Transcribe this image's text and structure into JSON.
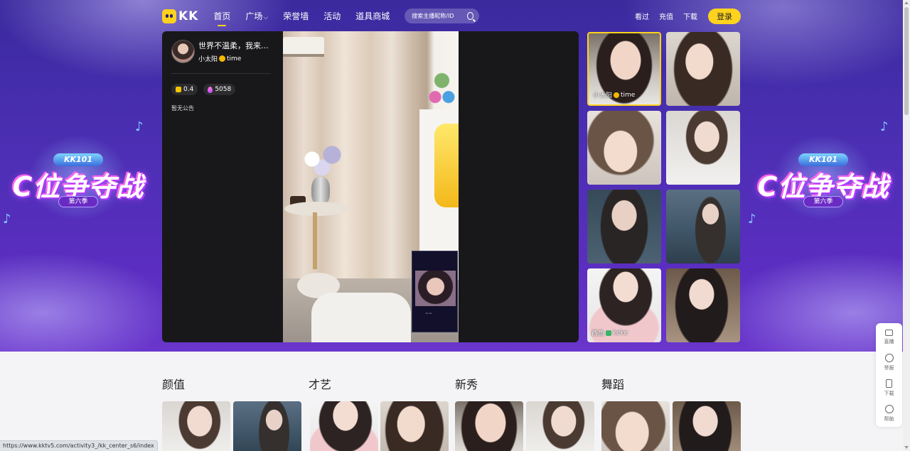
{
  "nav": {
    "logo_text": "KK",
    "items": [
      {
        "label": "首页",
        "active": true
      },
      {
        "label": "广场",
        "dropdown": true
      },
      {
        "label": "荣誉墙"
      },
      {
        "label": "活动"
      },
      {
        "label": "道具商城"
      }
    ],
    "search_placeholder": "搜索主播昵称/ID",
    "links": [
      "看过",
      "充值",
      "下载"
    ],
    "login_label": "登录"
  },
  "banner": {
    "top_text": "KK101",
    "main_text": "C位争夺战",
    "sub_text": "第六季"
  },
  "room": {
    "title": "世界不温柔，我来...",
    "anchor_name": "小太阳",
    "anchor_tag": "time",
    "bag_count": "0.4",
    "fire_count": "5058",
    "notice": "暂无公告"
  },
  "thumbs": [
    {
      "name": "小太阳",
      "tag": "time",
      "selected": true
    },
    {
      "name": ""
    },
    {
      "name": ""
    },
    {
      "name": ""
    },
    {
      "name": ""
    },
    {
      "name": ""
    },
    {
      "name": "西鱼",
      "tag": "keke"
    },
    {
      "name": ""
    }
  ],
  "categories": [
    {
      "title": "颜值"
    },
    {
      "title": "才艺"
    },
    {
      "title": "新秀"
    },
    {
      "title": "舞蹈"
    }
  ],
  "float_bar": [
    "直播",
    "举报",
    "下载",
    "帮助"
  ],
  "status_url": "https://www.kktv5.com/activity3_/kk_center_s6/index",
  "colors": {
    "accent": "#ffd21e",
    "hero_bg": "#4b2fb3",
    "player_bg": "#18181a"
  }
}
